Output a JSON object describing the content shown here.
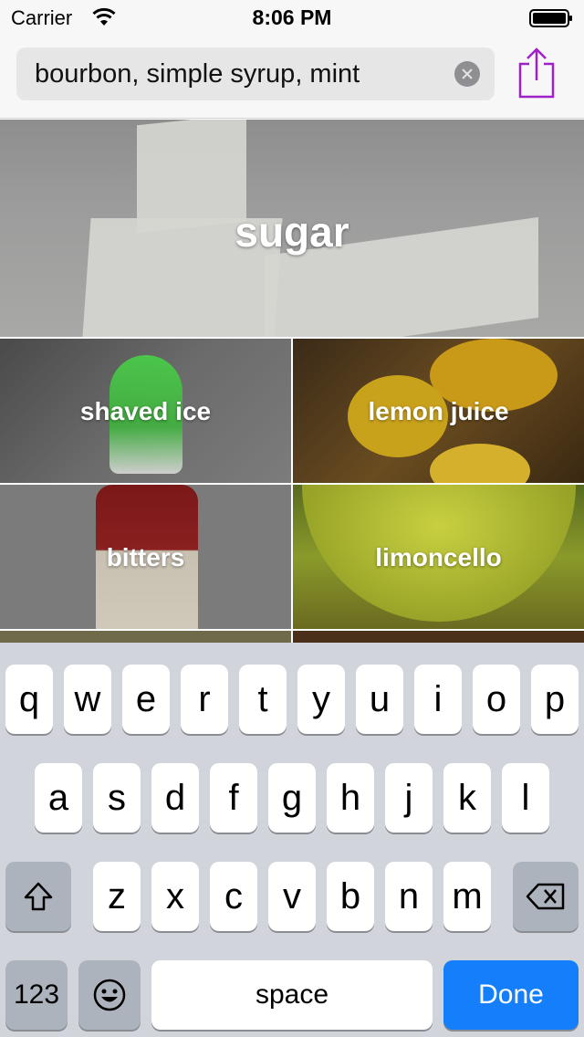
{
  "status_bar": {
    "carrier": "Carrier",
    "time": "8:06 PM"
  },
  "search": {
    "value": "bourbon, simple syrup, mint"
  },
  "colors": {
    "accent": "#a020c8",
    "keyboard_bg": "#d1d5db",
    "done_blue": "#147efb"
  },
  "tiles": [
    {
      "label": "sugar"
    },
    {
      "label": "shaved ice"
    },
    {
      "label": "lemon juice"
    },
    {
      "label": "bitters"
    },
    {
      "label": "limoncello"
    }
  ],
  "keyboard": {
    "row1": [
      "q",
      "w",
      "e",
      "r",
      "t",
      "y",
      "u",
      "i",
      "o",
      "p"
    ],
    "row2": [
      "a",
      "s",
      "d",
      "f",
      "g",
      "h",
      "j",
      "k",
      "l"
    ],
    "row3": [
      "z",
      "x",
      "c",
      "v",
      "b",
      "n",
      "m"
    ],
    "numbers_label": "123",
    "space_label": "space",
    "done_label": "Done",
    "icons": {
      "shift": "shift-icon",
      "delete": "delete-icon",
      "emoji": "emoji-icon"
    }
  }
}
